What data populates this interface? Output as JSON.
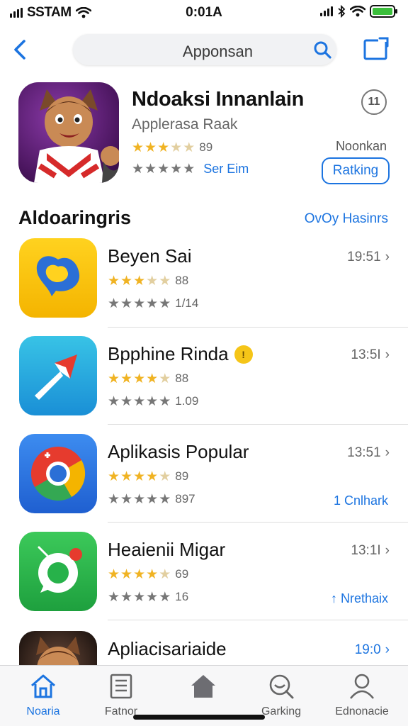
{
  "status": {
    "carrier": "SSTAM",
    "time": "0:01A"
  },
  "search": {
    "text": "Apponsan"
  },
  "featured": {
    "title": "Ndoaksi Innanlain",
    "subtitle": "Applerasa Raak",
    "rating_value": "89",
    "see_text": "Ser Eim",
    "count": "11",
    "side_label": "Noonkan",
    "button": "Ratking"
  },
  "section": {
    "title": "Aldoaringris",
    "link": "OvOy Hasinrs"
  },
  "apps": [
    {
      "title": "Beyen Sai",
      "r1": "88",
      "r2": "1/14",
      "time": "19:51",
      "action": "",
      "badge": ""
    },
    {
      "title": "Bpphine Rinda",
      "r1": "88",
      "r2": "1.09",
      "time": "13:5I",
      "action": "",
      "badge": "!"
    },
    {
      "title": "Aplikasis Popular",
      "r1": "89",
      "r2": "897",
      "time": "13:51",
      "action": "1 Cnlhark",
      "badge": ""
    },
    {
      "title": "Heaienii Migar",
      "r1": "69",
      "r2": "16",
      "time": "13:1I",
      "action": "↑ Nrethaix",
      "badge": ""
    },
    {
      "title": "Apliacisariaide",
      "r1": "",
      "r2": "",
      "time": "19:0",
      "action": "",
      "badge": ""
    }
  ],
  "tabs": [
    {
      "label": "Noaria",
      "icon": "home-outline-icon"
    },
    {
      "label": "Fatnor",
      "icon": "list-icon"
    },
    {
      "label": "",
      "icon": "home-filled-icon"
    },
    {
      "label": "Garking",
      "icon": "search-chat-icon"
    },
    {
      "label": "Ednonacie",
      "icon": "person-icon"
    }
  ],
  "colors": {
    "accent": "#1c74e0",
    "star": "#f0b323"
  }
}
